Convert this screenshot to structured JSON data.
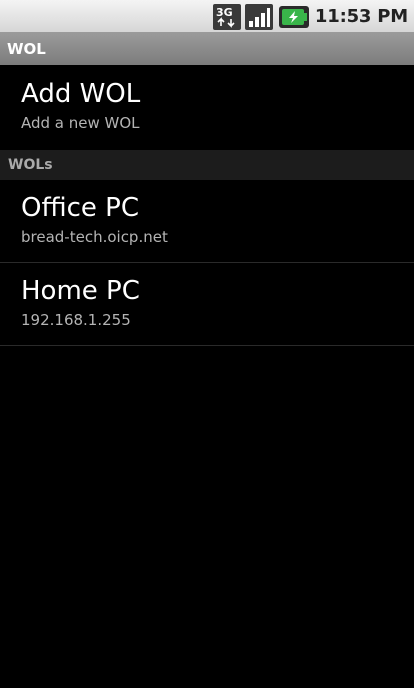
{
  "status_bar": {
    "network_type": "3G",
    "clock": "11:53 PM",
    "icons": [
      "3g-data-icon",
      "signal-strength-icon",
      "battery-charging-icon"
    ],
    "battery_color": "#39b54a"
  },
  "title_bar": {
    "title": "WOL"
  },
  "add_item": {
    "title": "Add WOL",
    "subtitle": "Add a new WOL"
  },
  "section": {
    "header": "WOLs"
  },
  "wols": [
    {
      "name": "Office PC",
      "address": "bread-tech.oicp.net"
    },
    {
      "name": "Home PC",
      "address": "192.168.1.255"
    }
  ]
}
